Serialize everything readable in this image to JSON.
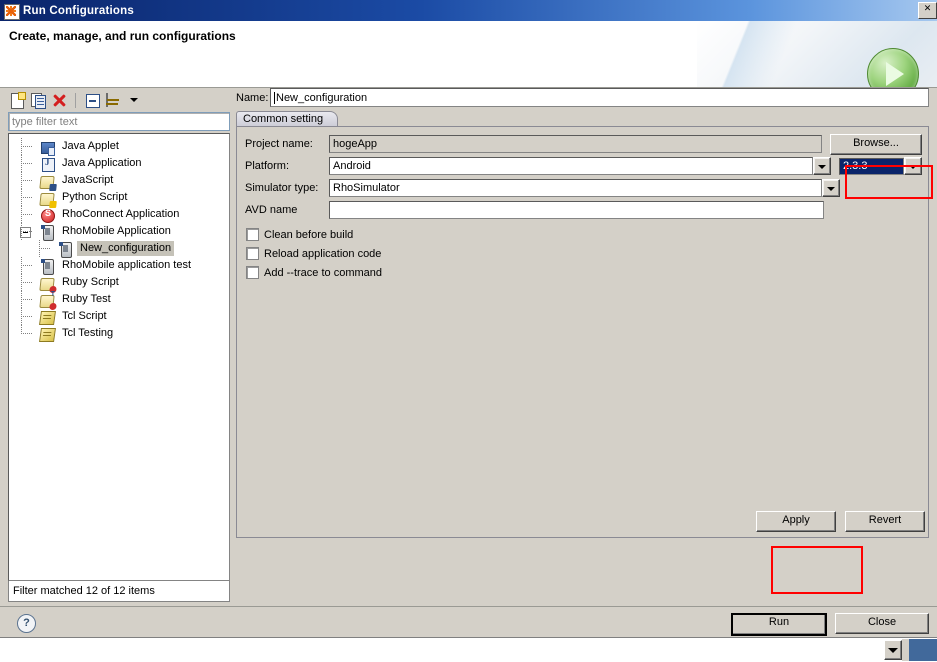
{
  "window": {
    "title": "Run Configurations",
    "icon": "eclipse-starburst-icon",
    "close_label": "✕"
  },
  "header": {
    "title": "Create, manage, and run configurations",
    "icon": "run-green-play-icon"
  },
  "toolbar": {
    "items": [
      {
        "name": "new-launch-configuration-icon",
        "tooltip": "New launch configuration"
      },
      {
        "name": "duplicate-configuration-icon",
        "tooltip": "Duplicate"
      },
      {
        "name": "delete-configuration-icon",
        "tooltip": "Delete"
      },
      {
        "name": "collapse-all-icon",
        "tooltip": "Collapse All"
      },
      {
        "name": "filter-launch-configurations-icon",
        "tooltip": "Filter"
      },
      {
        "name": "menu-chevron-down-icon",
        "tooltip": "View Menu"
      }
    ]
  },
  "filter": {
    "placeholder": "type filter text",
    "value": "",
    "status": "Filter matched 12 of 12 items"
  },
  "tree": {
    "items": [
      {
        "label": "Java Applet",
        "icon": "java-applet-icon",
        "indent": 0,
        "selected": false,
        "expander": "none"
      },
      {
        "label": "Java Application",
        "icon": "java-application-icon",
        "indent": 0,
        "selected": false,
        "expander": "none"
      },
      {
        "label": "JavaScript",
        "icon": "javascript-icon",
        "indent": 0,
        "selected": false,
        "expander": "none"
      },
      {
        "label": "Python Script",
        "icon": "python-script-icon",
        "indent": 0,
        "selected": false,
        "expander": "none"
      },
      {
        "label": "RhoConnect Application",
        "icon": "rhoconnect-icon",
        "indent": 0,
        "selected": false,
        "expander": "none"
      },
      {
        "label": "RhoMobile Application",
        "icon": "rhomobile-icon",
        "indent": 0,
        "selected": false,
        "expander": "expanded"
      },
      {
        "label": "New_configuration",
        "icon": "rhomobile-icon",
        "indent": 1,
        "selected": true,
        "expander": "none"
      },
      {
        "label": "RhoMobile application test",
        "icon": "rhomobile-icon",
        "indent": 0,
        "selected": false,
        "expander": "none"
      },
      {
        "label": "Ruby Script",
        "icon": "ruby-script-icon",
        "indent": 0,
        "selected": false,
        "expander": "none"
      },
      {
        "label": "Ruby Test",
        "icon": "ruby-test-icon",
        "indent": 0,
        "selected": false,
        "expander": "none"
      },
      {
        "label": "Tcl Script",
        "icon": "tcl-script-icon",
        "indent": 0,
        "selected": false,
        "expander": "none"
      },
      {
        "label": "Tcl Testing",
        "icon": "tcl-testing-icon",
        "indent": 0,
        "selected": false,
        "expander": "none"
      }
    ]
  },
  "form": {
    "name_label": "Name:",
    "name_value": "New_configuration",
    "tab_label": "Common setting",
    "fields": [
      {
        "label": "Project name:",
        "value": "hogeApp",
        "readonly": true
      },
      {
        "label": "Platform:",
        "value": "Android",
        "readonly": false
      },
      {
        "label": "Simulator type:",
        "value": "RhoSimulator",
        "readonly": false
      },
      {
        "label": "AVD name",
        "value": "",
        "readonly": false
      }
    ],
    "browse_label": "Browse...",
    "version_value": "2.3.3",
    "checkboxes": [
      {
        "label": "Clean before build",
        "checked": false
      },
      {
        "label": "Reload application code",
        "checked": false
      },
      {
        "label": "Add --trace to command",
        "checked": false
      }
    ]
  },
  "buttons": {
    "apply": "Apply",
    "revert": "Revert",
    "run": "Run",
    "close": "Close"
  },
  "help": {
    "label": "?"
  },
  "highlight_color": "#ff0000"
}
